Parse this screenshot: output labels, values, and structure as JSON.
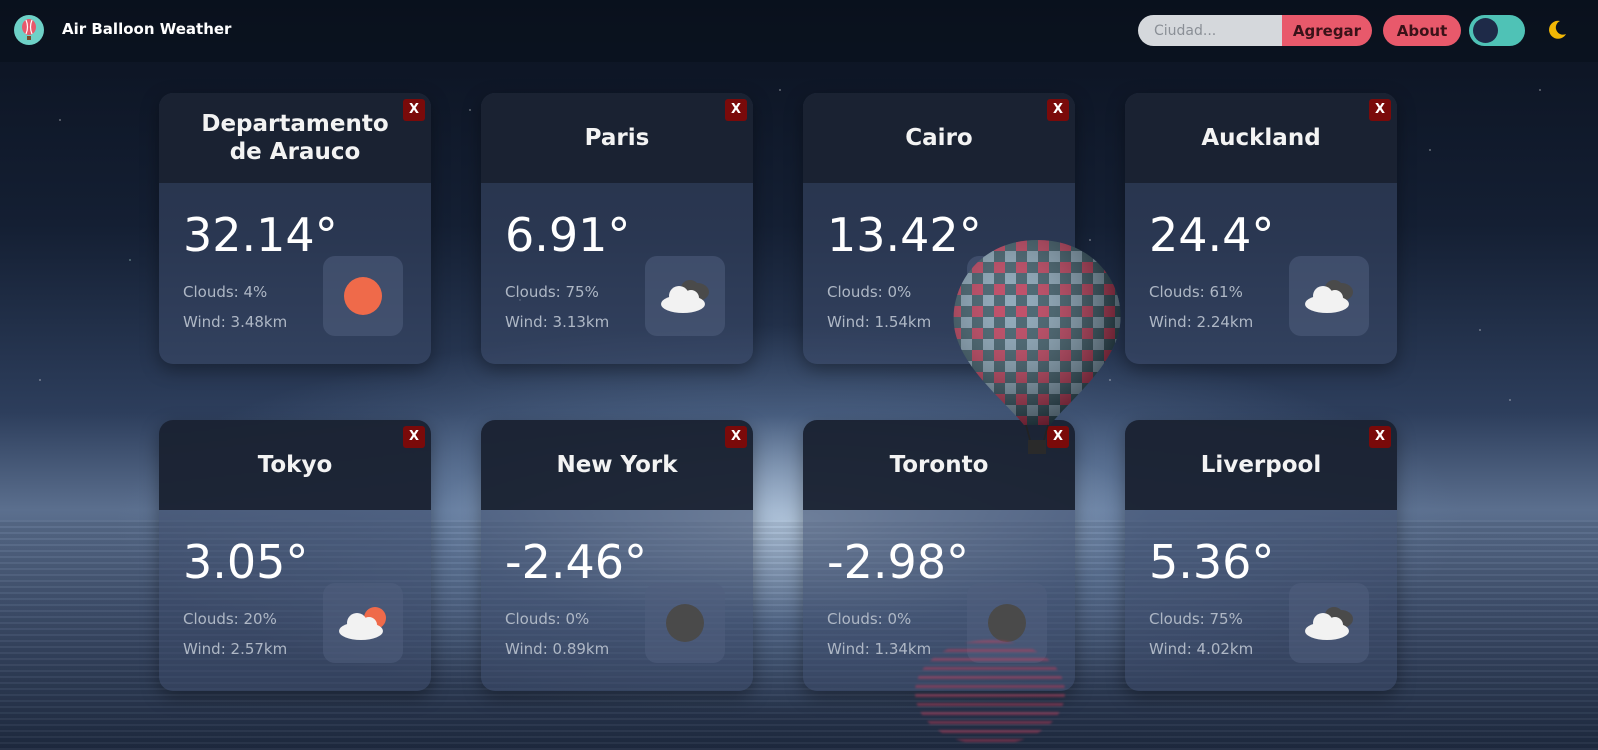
{
  "header": {
    "app_title": "Air Balloon Weather",
    "search_placeholder": "Ciudad...",
    "add_label": "Agregar",
    "about_label": "About"
  },
  "close_label": "X",
  "cards": [
    {
      "city": "Departamento de Arauco",
      "temp": "32.14°",
      "clouds": "Clouds: 4%",
      "wind": "Wind: 3.48km",
      "icon": "sun-icon"
    },
    {
      "city": "Paris",
      "temp": "6.91°",
      "clouds": "Clouds: 75%",
      "wind": "Wind: 3.13km",
      "icon": "broken-clouds-icon"
    },
    {
      "city": "Cairo",
      "temp": "13.42°",
      "clouds": "Clouds: 0%",
      "wind": "Wind: 1.54km",
      "icon": "clear-night-icon"
    },
    {
      "city": "Auckland",
      "temp": "24.4°",
      "clouds": "Clouds: 61%",
      "wind": "Wind: 2.24km",
      "icon": "broken-clouds-icon"
    },
    {
      "city": "Tokyo",
      "temp": "3.05°",
      "clouds": "Clouds: 20%",
      "wind": "Wind: 2.57km",
      "icon": "partly-cloudy-icon"
    },
    {
      "city": "New York",
      "temp": "-2.46°",
      "clouds": "Clouds: 0%",
      "wind": "Wind: 0.89km",
      "icon": "clear-night-icon"
    },
    {
      "city": "Toronto",
      "temp": "-2.98°",
      "clouds": "Clouds: 0%",
      "wind": "Wind: 1.34km",
      "icon": "clear-night-icon"
    },
    {
      "city": "Liverpool",
      "temp": "5.36°",
      "clouds": "Clouds: 75%",
      "wind": "Wind: 4.02km",
      "icon": "broken-clouds-icon"
    }
  ],
  "colors": {
    "accent": "#e8596b",
    "toggle": "#4fc2b6",
    "close": "#7a0a0a",
    "sun": "#ef6a4a",
    "moon": "#f2b705"
  }
}
